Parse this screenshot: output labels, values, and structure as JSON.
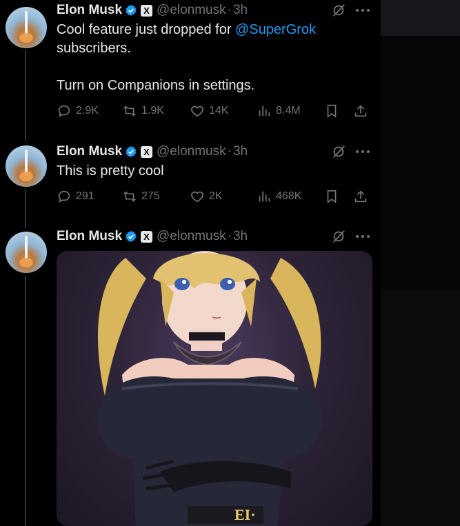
{
  "tweets": [
    {
      "name": "Elon Musk",
      "handle": "@elonmusk",
      "sep": "·",
      "time": "3h",
      "x_badge": "X",
      "text_before": "Cool feature just dropped for ",
      "mention": "@SuperGrok",
      "text_after": "\nsubscribers.\n\nTurn on Companions in settings.",
      "replies": "2.9K",
      "reposts": "1.9K",
      "likes": "14K",
      "views": "8.4M"
    },
    {
      "name": "Elon Musk",
      "handle": "@elonmusk",
      "sep": "·",
      "time": "3h",
      "x_badge": "X",
      "text": "This is pretty cool",
      "replies": "291",
      "reposts": "275",
      "likes": "2K",
      "views": "468K"
    },
    {
      "name": "Elon Musk",
      "handle": "@elonmusk",
      "sep": "·",
      "time": "3h",
      "x_badge": "X",
      "media_caption": "EI·"
    }
  ],
  "colors": {
    "background": "#000000",
    "text": "#e7e9ea",
    "muted": "#71767b",
    "link": "#1d9bf0",
    "verified": "#1d9bf0"
  },
  "icons": [
    "grok-icon",
    "more-icon",
    "reply-icon",
    "repost-icon",
    "like-icon",
    "views-icon",
    "bookmark-icon",
    "share-icon",
    "verified-icon"
  ]
}
